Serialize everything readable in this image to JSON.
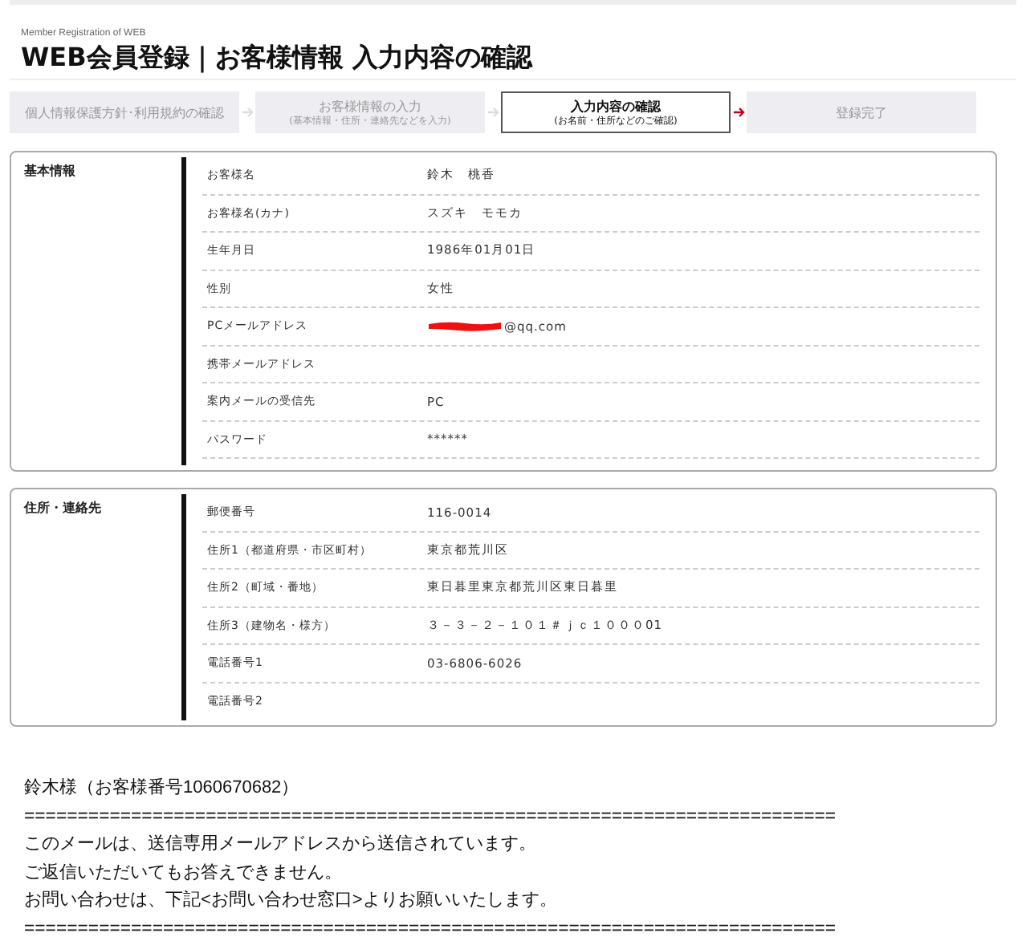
{
  "header": {
    "subtitle": "Member Registration of WEB",
    "title": "WEB会員登録｜お客様情報 入力内容の確認"
  },
  "steps": [
    {
      "label": "個人情報保護方針･利用規約の確認",
      "selected": false
    },
    {
      "label": "お客様情報の入力",
      "sub": "(基本情報・住所・連絡先などを入力)",
      "selected": false
    },
    {
      "label": "入力内容の確認",
      "sub": "(お名前・住所などのご確認)",
      "selected": true
    },
    {
      "label": "登録完了",
      "selected": false
    }
  ],
  "sections": [
    {
      "title": "基本情報",
      "rows": [
        {
          "label": "お客様名",
          "value": "鈴木　桃香"
        },
        {
          "label": "お客様名(カナ)",
          "value": "スズキ　モモカ"
        },
        {
          "label": "生年月日",
          "value": "1986年01月01日"
        },
        {
          "label": "性別",
          "value": "女性"
        },
        {
          "label": "PCメールアドレス",
          "value": "@qq.com",
          "redacted": true
        },
        {
          "label": "携帯メールアドレス"
        },
        {
          "label": "案内メールの受信先",
          "value": "PC"
        },
        {
          "label": "パスワード",
          "value": "******"
        }
      ],
      "trailing_rule": true
    },
    {
      "title": "住所・連絡先",
      "rows": [
        {
          "label": "郵便番号",
          "value": "116-0014"
        },
        {
          "label": "住所1（都道府県・市区町村）",
          "value": "東京都荒川区"
        },
        {
          "label": "住所2（町域・番地）",
          "value": "東日暮里東京都荒川区東日暮里"
        },
        {
          "label": "住所3（建物名・様方）",
          "value": "３－３－２－１０１＃ｊｃ１０００01"
        },
        {
          "label": "電話番号1",
          "value": "03-6806-6026"
        },
        {
          "label": "電話番号2"
        }
      ],
      "trailing_rule": false
    }
  ],
  "email": {
    "lines": [
      "鈴木様（お客様番号1060670682）",
      "============================================================================",
      "このメールは、送信専用メールアドレスから送信されています。",
      "ご返信いただいてもお答えできません。",
      "お問い合わせは、下記<お問い合わせ窓口>よりお願いいたします。",
      "============================================================================"
    ]
  }
}
